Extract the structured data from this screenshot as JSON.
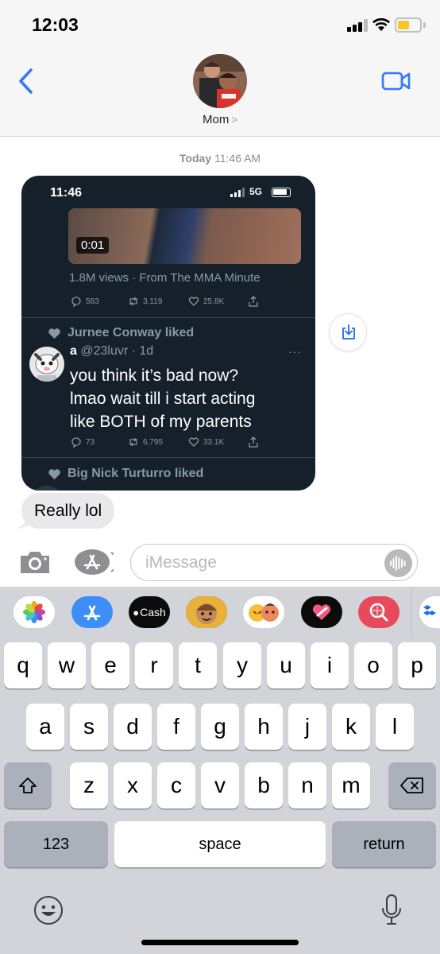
{
  "status_bar": {
    "time": "12:03"
  },
  "header": {
    "contact_name": "Mom",
    "chevron": ">",
    "avatar_icon": "contact-photo"
  },
  "thread": {
    "timestamp_day": "Today",
    "timestamp_time": "11:46 AM",
    "screenshot": {
      "status_time": "11:46",
      "network": "5G",
      "video_duration": "0:01",
      "views_text": "1.8M views · From The MMA Minute",
      "tweet1_metrics": {
        "replies": "583",
        "retweets": "3,119",
        "likes": "25.8K"
      },
      "liked_by_1": "Jurnee Conway liked",
      "tweet2": {
        "display_name": "a",
        "handle_time": "@23luvr · 1d",
        "more": "···",
        "text_lines": [
          "you think it’s bad now?",
          "lmao wait till i start acting",
          "like BOTH of my parents"
        ],
        "replies": "73",
        "retweets": "6,795",
        "likes": "33.1K"
      },
      "liked_by_2": "Big Nick Turturro liked"
    },
    "reply_bubble": "Really lol"
  },
  "input": {
    "placeholder": "iMessage"
  },
  "app_strip": {
    "items": [
      "photos-icon",
      "app-store-icon",
      "cash-app-icon",
      "memoji-icon",
      "memoji-stickers-icon",
      "digital-touch-icon",
      "images-search-icon",
      "dropbox-icon"
    ],
    "cash_label": "Cash"
  },
  "keyboard": {
    "row1": [
      "q",
      "w",
      "e",
      "r",
      "t",
      "y",
      "u",
      "i",
      "o",
      "p"
    ],
    "row2": [
      "a",
      "s",
      "d",
      "f",
      "g",
      "h",
      "j",
      "k",
      "l"
    ],
    "row3": [
      "z",
      "x",
      "c",
      "v",
      "b",
      "n",
      "m"
    ],
    "numbers_label": "123",
    "space_label": "space",
    "return_label": "return"
  },
  "colors": {
    "ios_blue": "#3478f6",
    "bubble_gray": "#e9e9eb",
    "twitter_dark": "#15202b",
    "keyboard_bg": "#d2d4d9"
  }
}
